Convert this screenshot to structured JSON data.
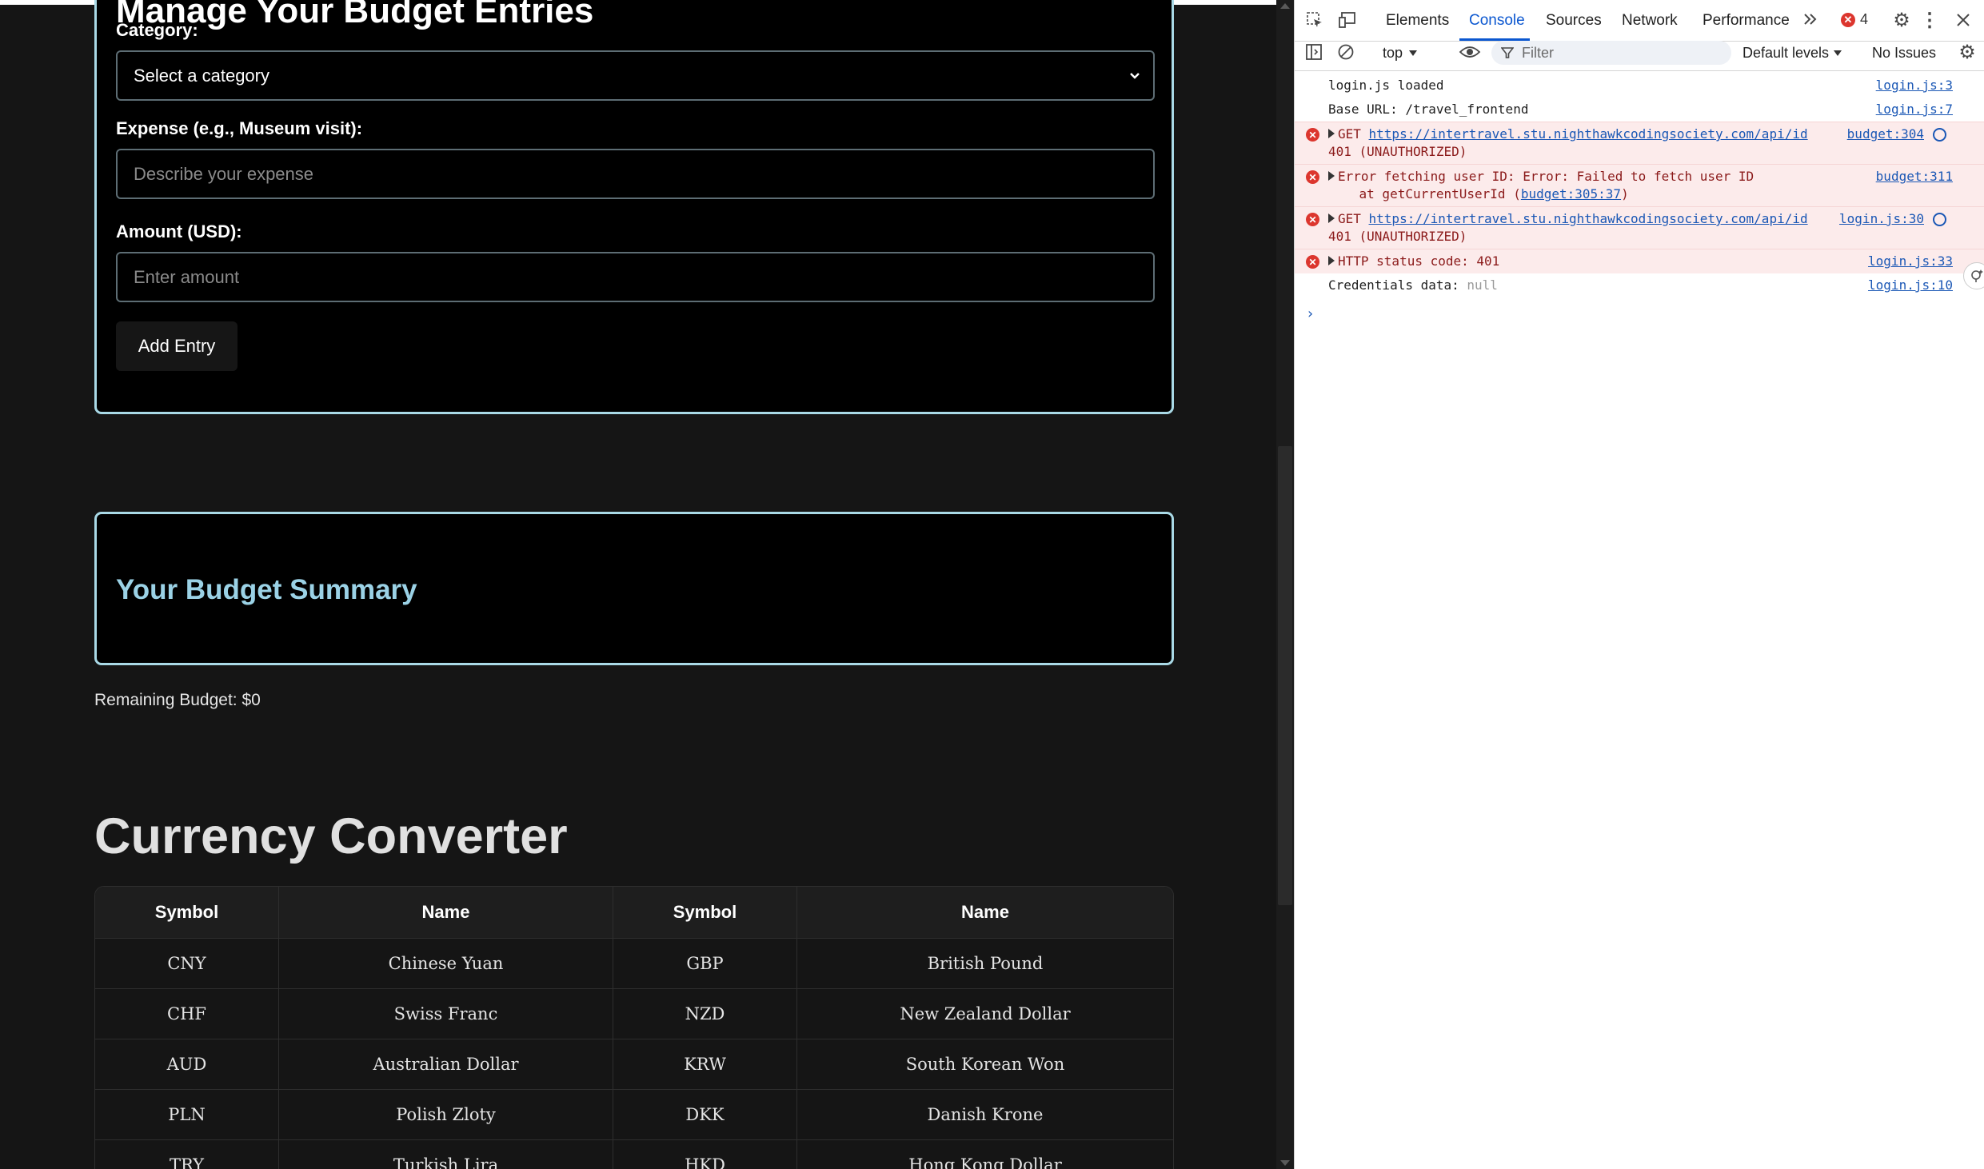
{
  "budget_form": {
    "title": "Manage Your Budget Entries",
    "category_label": "Category:",
    "category_value": "Select a category",
    "expense_label": "Expense (e.g., Museum visit):",
    "expense_placeholder": "Describe your expense",
    "amount_label": "Amount (USD):",
    "amount_placeholder": "Enter amount",
    "add_button": "Add Entry"
  },
  "summary": {
    "title": "Your Budget Summary",
    "remaining": "Remaining Budget: $0"
  },
  "currency": {
    "title": "Currency Converter",
    "headers": [
      "Symbol",
      "Name",
      "Symbol",
      "Name"
    ],
    "rows": [
      [
        "CNY",
        "Chinese Yuan",
        "GBP",
        "British Pound"
      ],
      [
        "CHF",
        "Swiss Franc",
        "NZD",
        "New Zealand Dollar"
      ],
      [
        "AUD",
        "Australian Dollar",
        "KRW",
        "South Korean Won"
      ],
      [
        "PLN",
        "Polish Zloty",
        "DKK",
        "Danish Krone"
      ],
      [
        "TRY",
        "Turkish Lira",
        "HKD",
        "Hong Kong Dollar"
      ]
    ]
  },
  "devtools": {
    "tabs": [
      "Elements",
      "Console",
      "Sources",
      "Network",
      "Performance"
    ],
    "error_count": "4",
    "context": "top",
    "filter_placeholder": "Filter",
    "levels": "Default levels",
    "issues": "No Issues",
    "logs": [
      {
        "type": "log",
        "text": "login.js loaded",
        "src": "login.js:3"
      },
      {
        "type": "log",
        "text": "Base URL: /travel_frontend",
        "src": "login.js:7"
      },
      {
        "type": "error",
        "prefix": "GET ",
        "url": "https://intertravel.stu.nighthawkcodingsociety.com/api/id",
        "line2": "401 (UNAUTHORIZED)",
        "src": "budget:304"
      },
      {
        "type": "error",
        "text": "Error fetching user ID: Error: Failed to fetch user ID",
        "line2_prefix": "    at getCurrentUserId (",
        "line2_link": "budget:305:37",
        "line2_suffix": ")",
        "src": "budget:311"
      },
      {
        "type": "error",
        "prefix": "GET ",
        "url": "https://intertravel.stu.nighthawkcodingsociety.com/api/id",
        "line2": "401 (UNAUTHORIZED)",
        "src": "login.js:30"
      },
      {
        "type": "error",
        "text": "HTTP status code: 401",
        "src": "login.js:33"
      },
      {
        "type": "log",
        "text": "Credentials data: ",
        "null": "null",
        "src": "login.js:10"
      }
    ]
  }
}
